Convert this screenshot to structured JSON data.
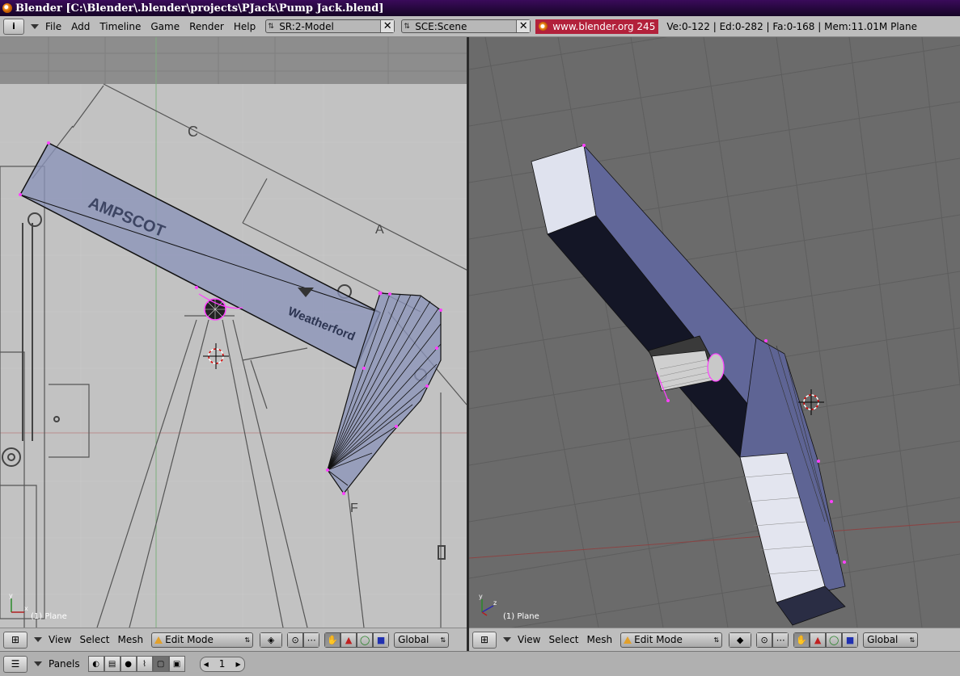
{
  "window": {
    "title": "Blender [C:\\Blender\\.blender\\projects\\PJack\\Pump Jack.blend]"
  },
  "topbar": {
    "info_icon": "i",
    "menus": [
      "File",
      "Add",
      "Timeline",
      "Game",
      "Render",
      "Help"
    ],
    "screen_select": "SR:2-Model",
    "scene_select": "SCE:Scene",
    "url": "www.blender.org 245",
    "stats": "Ve:0-122 | Ed:0-282 | Fa:0-168 | Mem:11.01M Plane",
    "close_glyph": "✕"
  },
  "viewport_left": {
    "label": "(1) Plane",
    "background_texts": {
      "dim_c": "C",
      "dim_a": "A",
      "dim_f": "F",
      "logo_ampscot": "AMPSCOT",
      "logo_weatherford": "Weatherford"
    }
  },
  "viewport_right": {
    "label": "(1) Plane"
  },
  "view_header_left": {
    "menus": [
      "View",
      "Select",
      "Mesh"
    ],
    "mode": "Edit Mode",
    "orientation": "Global"
  },
  "view_header_right": {
    "menus": [
      "View",
      "Select",
      "Mesh"
    ],
    "mode": "Edit Mode",
    "orientation": "Global"
  },
  "buttons_header": {
    "panels_label": "Panels",
    "page_value": "1"
  },
  "colors": {
    "title_bar": "#2a0a45",
    "url_bg": "#b2213b",
    "selection_vertex": "#ff40ff",
    "mesh_face": "#8a93b8"
  }
}
